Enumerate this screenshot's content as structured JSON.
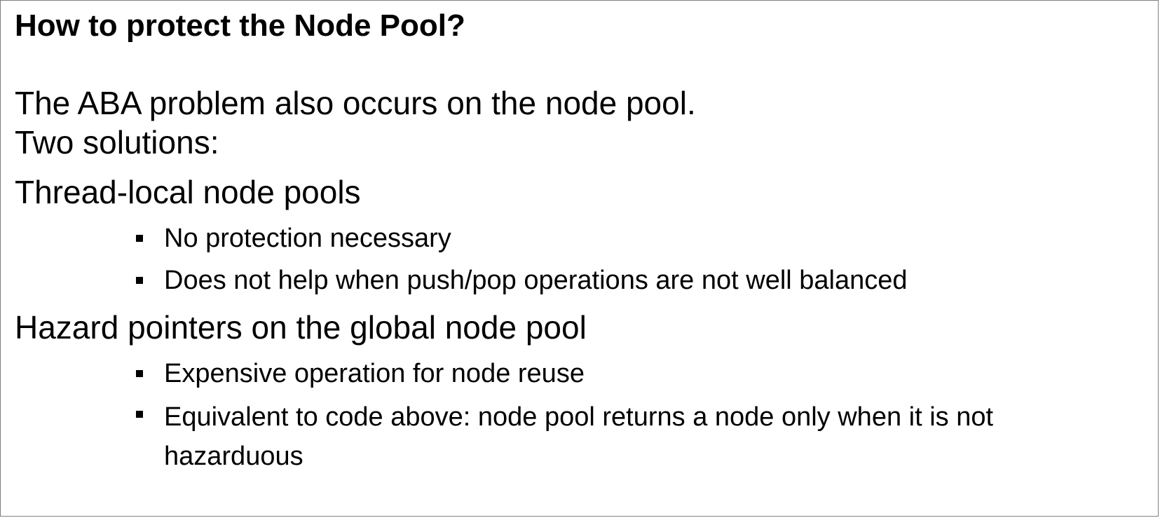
{
  "slide": {
    "title": "How to protect the Node Pool?",
    "intro": "The ABA problem also occurs on the node pool.",
    "subheading": "Two solutions:",
    "solutions": [
      {
        "heading": "Thread-local node pools",
        "bullets": [
          "No protection necessary",
          "Does not help when push/pop operations are not well balanced"
        ]
      },
      {
        "heading": "Hazard pointers on the global node pool",
        "bullets": [
          "Expensive operation for node reuse",
          "Equivalent to code above: node pool returns a node only when it is not hazarduous"
        ]
      }
    ]
  }
}
